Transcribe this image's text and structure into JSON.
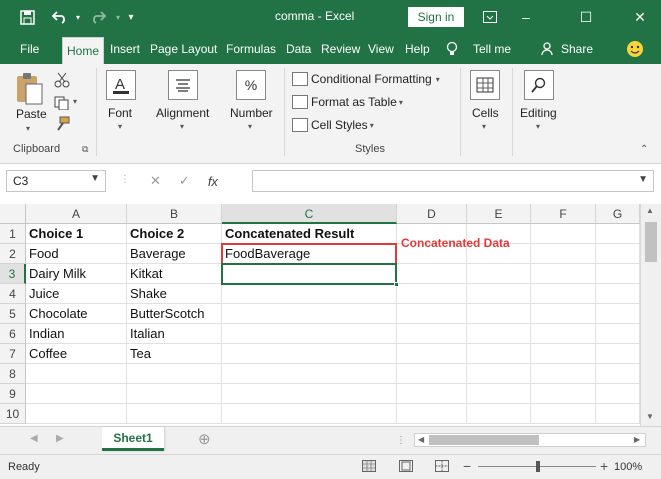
{
  "titlebar": {
    "title": "comma - Excel",
    "signin": "Sign in",
    "save_icon": "save-icon",
    "undo_icon": "undo-icon",
    "redo_icon": "redo-icon",
    "customize_icon": "chevron-down-icon",
    "restore_icon": "ribbon-display-icon",
    "minimize": "–",
    "maximize": "☐",
    "close": "✕",
    "accent": "#217346"
  },
  "tabs": [
    {
      "label": "File"
    },
    {
      "label": "Home"
    },
    {
      "label": "Insert"
    },
    {
      "label": "Page Layout"
    },
    {
      "label": "Formulas"
    },
    {
      "label": "Data"
    },
    {
      "label": "Review"
    },
    {
      "label": "View"
    },
    {
      "label": "Help"
    },
    {
      "label": "Tell me"
    },
    {
      "label": "Share"
    }
  ],
  "ribbon": {
    "clipboard": {
      "paste": "Paste",
      "group_label": "Clipboard"
    },
    "font": {
      "label": "Font"
    },
    "alignment": {
      "label": "Alignment"
    },
    "number": {
      "label": "Number"
    },
    "styles": {
      "conditional": "Conditional Formatting",
      "format_table": "Format as Table",
      "cell_styles": "Cell Styles",
      "group_label": "Styles"
    },
    "cells": {
      "label": "Cells"
    },
    "editing": {
      "label": "Editing"
    }
  },
  "formula_bar": {
    "namebox": "C3",
    "cancel": "✕",
    "enter": "✓",
    "fx": "fx",
    "formula": ""
  },
  "grid": {
    "columns": [
      "A",
      "B",
      "C",
      "D",
      "E",
      "F",
      "G"
    ],
    "rows": [
      "1",
      "2",
      "3",
      "4",
      "5",
      "6",
      "7",
      "8",
      "9",
      "10"
    ],
    "cells": {
      "A1": "Choice 1",
      "B1": "Choice 2",
      "C1": "Concatenated Result",
      "A2": "Food",
      "B2": "Baverage",
      "C2": "FoodBaverage",
      "A3": "Dairy Milk",
      "B3": "Kitkat",
      "A4": "Juice",
      "B4": "Shake",
      "A5": "Chocolate",
      "B5": "ButterScotch",
      "A6": "Indian",
      "B6": "Italian",
      "A7": "Coffee",
      "B7": "Tea"
    },
    "annotation": "Concatenated Data"
  },
  "sheets": {
    "active": "Sheet1",
    "add": "⊕"
  },
  "status": {
    "ready": "Ready",
    "zoom": "100%",
    "minus": "−",
    "plus": "+"
  }
}
